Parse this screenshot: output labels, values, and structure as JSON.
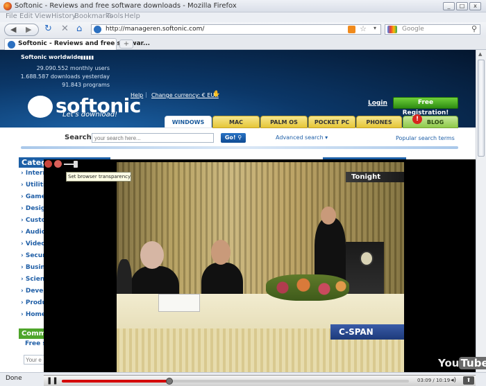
{
  "window": {
    "title": "Softonic - Reviews and free software downloads - Mozilla Firefox",
    "buttons": [
      "_",
      "□",
      "x"
    ]
  },
  "menu": [
    "File",
    "Edit",
    "View",
    "History",
    "Bookmarks",
    "Tools",
    "Help"
  ],
  "address": {
    "url": "http://manageren.softonic.com/",
    "search_placeholder": "Google"
  },
  "tab": {
    "label": "Softonic - Reviews and free softwar...",
    "new_tab": "+"
  },
  "site": {
    "worldwide": "Softonic worldwide",
    "stats": [
      "29.090.552 monthly users",
      "1.688.587 downloads yesterday",
      "91.843 programs"
    ],
    "help": "Help",
    "currency": "Change currency: € EUR",
    "logo": "softonic",
    "slogan": "Let's download!",
    "login": "Login",
    "free_registration": "Free Registration!",
    "nav": [
      "WINDOWS",
      "MAC",
      "PALM OS",
      "POCKET PC",
      "PHONES",
      "BLOG"
    ],
    "search_label": "Search:",
    "search_placeholder": "your search here...",
    "go": "Go!",
    "advanced": "Advanced search",
    "popular": "Popular search terms",
    "categories_title": "Categ",
    "categories": [
      "Intern",
      "Utilitie",
      "Games",
      "Design",
      "Custom",
      "Audio",
      "Video",
      "Securi",
      "Busine",
      "Scienc",
      "Develo",
      "Produc",
      "Home"
    ],
    "community_title": "Comm",
    "free_sub": "Free s",
    "your_input": "Your e"
  },
  "overlay": {
    "tooltip": "Set browser transparency",
    "tonight": "Tonight",
    "cspan": "C-SPAN",
    "yt_you": "You",
    "yt_tube": "Tube",
    "time": "03:09 / 10:19",
    "progress": 0.31
  },
  "status": "Done"
}
